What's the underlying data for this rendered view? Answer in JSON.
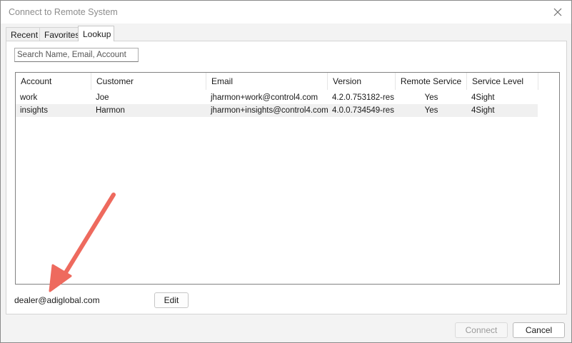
{
  "window": {
    "title": "Connect to Remote System"
  },
  "tabs": [
    {
      "label": "Recent",
      "active": false
    },
    {
      "label": "Favorites",
      "active": false
    },
    {
      "label": "Lookup",
      "active": true
    }
  ],
  "search": {
    "placeholder": "Search Name, Email, Account",
    "value": ""
  },
  "table": {
    "columns": [
      "Account",
      "Customer",
      "Email",
      "Version",
      "Remote Service",
      "Service Level"
    ],
    "rows": [
      [
        "work",
        "Joe",
        "jharmon+work@control4.com",
        "4.2.0.753182-res",
        "Yes",
        "4Sight"
      ],
      [
        "insights",
        "Harmon",
        "jharmon+insights@control4.com",
        "4.0.0.734549-res",
        "Yes",
        "4Sight"
      ]
    ]
  },
  "footer": {
    "account_email": "dealer@adiglobal.com",
    "edit_label": "Edit"
  },
  "buttons": {
    "connect_label": "Connect",
    "cancel_label": "Cancel"
  },
  "colors": {
    "annotation_arrow": "#ee6a5e",
    "selected_row": "#f0f0f0"
  },
  "icons": {
    "close": "close-icon",
    "annotation": "arrow-annotation-icon"
  }
}
